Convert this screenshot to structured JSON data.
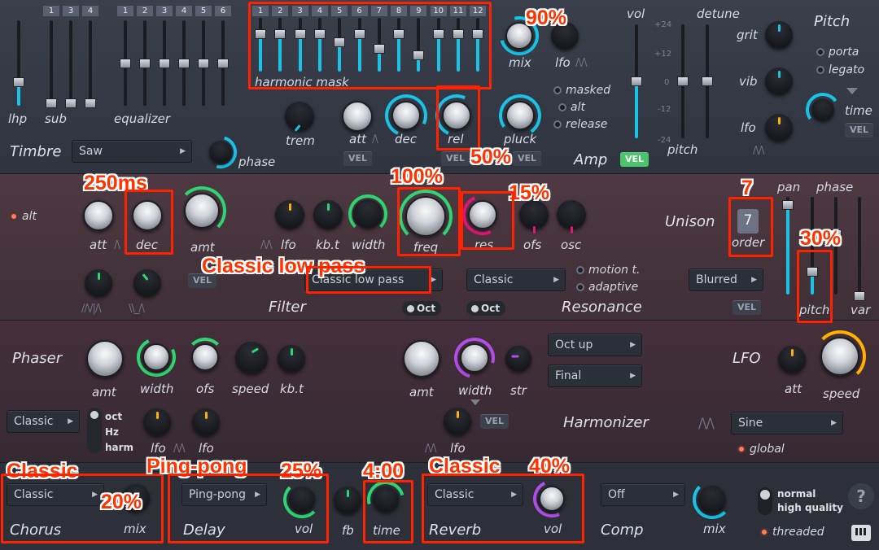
{
  "colors": {
    "accent_cyan": "#19c3e6",
    "accent_green": "#2ed573",
    "accent_purple": "#b14ee8",
    "accent_orange": "#ffb000",
    "annotation": "#ff3300",
    "vel_on": "#4bc56b"
  },
  "timbre": {
    "section": "Timbre",
    "lhp": "lhp",
    "sub": "sub",
    "equalizer": "equalizer",
    "sub_nums": [
      "1",
      "3",
      "4"
    ],
    "eq_nums": [
      "1",
      "2",
      "3",
      "4",
      "5",
      "6"
    ],
    "mask_nums": [
      "1",
      "2",
      "3",
      "4",
      "5",
      "6",
      "7",
      "8",
      "9",
      "10",
      "11",
      "12"
    ],
    "harmonic_mask": "harmonic mask",
    "wave_select": "Saw",
    "phase": "phase",
    "mix": "mix",
    "lfo": "lfo",
    "trem": "trem"
  },
  "amp": {
    "section": "Amp",
    "att": "att",
    "dec": "dec",
    "rel": "rel",
    "pluck": "pluck",
    "vel": "VEL",
    "radios": [
      "masked",
      "alt",
      "release"
    ]
  },
  "voice": {
    "vol": "vol",
    "detune": "detune",
    "pitch": "pitch",
    "ticks": [
      "+24",
      "+12",
      "0",
      "-12",
      "-24"
    ],
    "vel": "VEL"
  },
  "pitch": {
    "section": "Pitch",
    "grit": "grit",
    "vib": "vib",
    "lfo": "lfo",
    "porta": "porta",
    "legato": "legato",
    "time": "time",
    "vel": "VEL"
  },
  "filter": {
    "section": "Filter",
    "alt": "alt",
    "att": "att",
    "dec": "dec",
    "amt": "amt",
    "lfo": "lfo",
    "kbt": "kb.t",
    "width": "width",
    "freq": "freq",
    "res": "res",
    "ofs": "ofs",
    "osc": "osc",
    "type": "Classic low pass",
    "oct": "Oct",
    "vel": "VEL"
  },
  "resonance": {
    "section": "Resonance",
    "type": "Classic",
    "oct": "Oct",
    "radios": [
      "motion t.",
      "adaptive"
    ]
  },
  "unison": {
    "section": "Unison",
    "order_value": "7",
    "order": "order",
    "mode": "Blurred",
    "vel": "VEL",
    "pan": "pan",
    "phase": "phase",
    "pitch": "pitch",
    "var": "var"
  },
  "phaser": {
    "section": "Phaser",
    "amt": "amt",
    "width": "width",
    "ofs": "ofs",
    "speed": "speed",
    "kbt": "kb.t",
    "type": "Classic",
    "modes": [
      "oct",
      "Hz",
      "harm"
    ],
    "lfo1": "lfo",
    "lfo2": "lfo"
  },
  "harmonizer": {
    "section": "Harmonizer",
    "amt": "amt",
    "width": "width",
    "str": "str",
    "lfo": "lfo",
    "vel": "VEL",
    "select1": "Oct up",
    "select2": "Final"
  },
  "lfo": {
    "section": "LFO",
    "att": "att",
    "speed": "speed",
    "shape": "Sine",
    "global": "global"
  },
  "fx": {
    "chorus": {
      "name": "Chorus",
      "type": "Classic",
      "mix": "mix"
    },
    "delay": {
      "name": "Delay",
      "type": "Ping-pong",
      "vol": "vol",
      "fb": "fb",
      "time": "time"
    },
    "reverb": {
      "name": "Reverb",
      "type": "Classic",
      "vol": "vol"
    },
    "comp": {
      "name": "Comp",
      "type": "Off",
      "mix": "mix"
    },
    "quality_normal": "normal",
    "quality_high": "high quality",
    "threaded": "threaded",
    "help": "?"
  },
  "annotations": {
    "mask_mix": "90%",
    "rel": "50%",
    "dec": "250ms",
    "freq": "100%",
    "res": "15%",
    "order": "7",
    "filter_type": "Classic low pass",
    "pitch": "30%",
    "chorus_type": "Classic",
    "chorus_mix": "20%",
    "delay_type": "Ping-pong",
    "delay_vol": "25%",
    "delay_time": "4:00",
    "reverb_type": "Classic",
    "reverb_vol": "40%"
  }
}
